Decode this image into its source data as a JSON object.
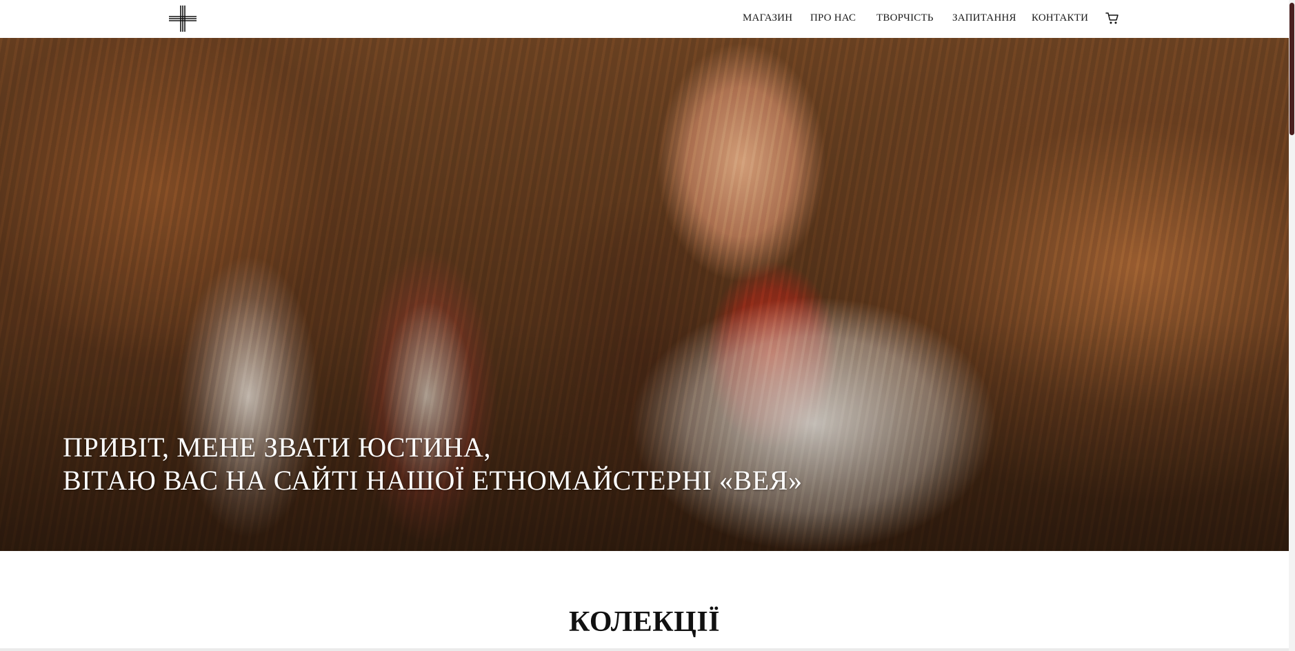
{
  "header": {
    "logo_icon": "cross-ornament-logo",
    "nav": [
      {
        "label": "МАГАЗИН"
      },
      {
        "label": "ПРО НАС"
      },
      {
        "label": "ТВОРЧІСТЬ"
      },
      {
        "label": "ЗАПИТАННЯ"
      },
      {
        "label": "КОНТАКТИ"
      }
    ],
    "cart_icon": "cart-icon"
  },
  "hero": {
    "line1": "ПРИВІТ, МЕНЕ ЗВАТИ ЮСТИНА,",
    "line2": "ВІТАЮ ВАС НА САЙТІ НАШОЇ ЕТНОМАЙСТЕРНІ «ВЕЯ»"
  },
  "collections": {
    "title": "КОЛЕКЦІЇ"
  },
  "colors": {
    "text": "#111111",
    "hero_text": "#ffffff",
    "scrollbar_thumb": "#4a1f1f"
  }
}
